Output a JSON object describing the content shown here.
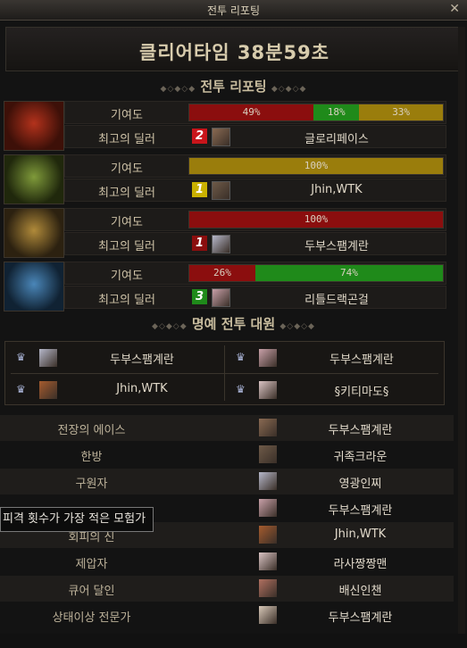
{
  "window": {
    "title": "전투 리포팅",
    "close_glyph": "✕"
  },
  "clear_time": "클리어타임  38분59초",
  "sections": {
    "report": "전투 리포팅",
    "honor": "명예 전투 대원"
  },
  "labels": {
    "contribution": "기여도",
    "best_dealer": "최고의 딜러"
  },
  "bosses": [
    {
      "icon": "red-demon-boss-icon",
      "segments": [
        {
          "text": "49%",
          "pct": 49,
          "color": "#8b0e0e"
        },
        {
          "text": "18%",
          "pct": 18,
          "color": "#1f8a1a"
        },
        {
          "text": "33%",
          "pct": 33,
          "color": "#9a7d0c"
        }
      ],
      "rank": "2",
      "rank_color": "#c8151b",
      "dealer": "글로리페이스"
    },
    {
      "icon": "green-demon-boss-icon",
      "segments": [
        {
          "text": "100%",
          "pct": 100,
          "color": "#9a7d0c"
        }
      ],
      "rank": "1",
      "rank_color": "#c9b000",
      "dealer": "Jhin,WTK"
    },
    {
      "icon": "gold-demon-boss-icon",
      "segments": [
        {
          "text": "100%",
          "pct": 100,
          "color": "#8b0e0e"
        }
      ],
      "rank": "1",
      "rank_color": "#8b0e0e",
      "dealer": "두부스팸계란"
    },
    {
      "icon": "blue-demon-boss-icon",
      "segments": [
        {
          "text": "26%",
          "pct": 26,
          "color": "#8b0e0e"
        },
        {
          "text": "74%",
          "pct": 74,
          "color": "#1f8a1a"
        }
      ],
      "rank": "3",
      "rank_color": "#1f8a1a",
      "dealer": "리틀드랙곤걸"
    }
  ],
  "honor": [
    {
      "name": "두부스팸계란"
    },
    {
      "name": "두부스팸계란"
    },
    {
      "name": "Jhin,WTK"
    },
    {
      "name": "§키티마도§"
    }
  ],
  "awards": [
    {
      "award": "전장의 에이스",
      "name": "두부스팸계란"
    },
    {
      "award": "한방",
      "name": "귀족크라운"
    },
    {
      "award": "구원자",
      "name": "영광인찌"
    },
    {
      "award": "",
      "name": "두부스팸계란"
    },
    {
      "award": "회피의 신",
      "name": "Jhin,WTK"
    },
    {
      "award": "제압자",
      "name": "라사짱짱맨"
    },
    {
      "award": "큐어 달인",
      "name": "배신인챈"
    },
    {
      "award": "상태이상 전문가",
      "name": "두부스팸계란"
    }
  ],
  "tooltip": "피격 횟수가 가장 적은 모험가"
}
